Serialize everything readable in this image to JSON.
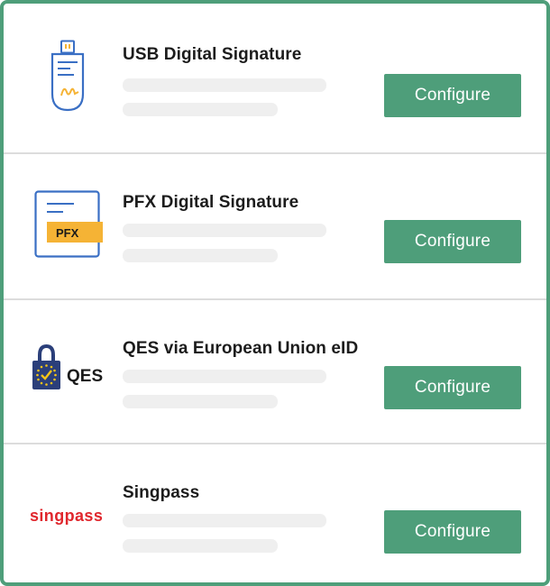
{
  "options": [
    {
      "title": "USB Digital Signature",
      "button_label": "Configure",
      "icon": "usb-drive-icon"
    },
    {
      "title": "PFX Digital Signature",
      "button_label": "Configure",
      "icon": "pfx-document-icon",
      "badge": "PFX"
    },
    {
      "title": "QES via European Union eID",
      "button_label": "Configure",
      "icon": "qes-lock-icon",
      "logo_text": "QES"
    },
    {
      "title": "Singpass",
      "button_label": "Configure",
      "icon": "singpass-logo",
      "logo_text": "singpass"
    }
  ],
  "colors": {
    "accent": "#4e9e7a",
    "skeleton": "#efefef",
    "divider": "#dcdcdc",
    "pfx_badge": "#f5b335",
    "eu_blue": "#2b3f7a",
    "eu_star": "#f5c518",
    "singpass_red": "#e0272d",
    "usb_outline": "#3a6fc4"
  }
}
